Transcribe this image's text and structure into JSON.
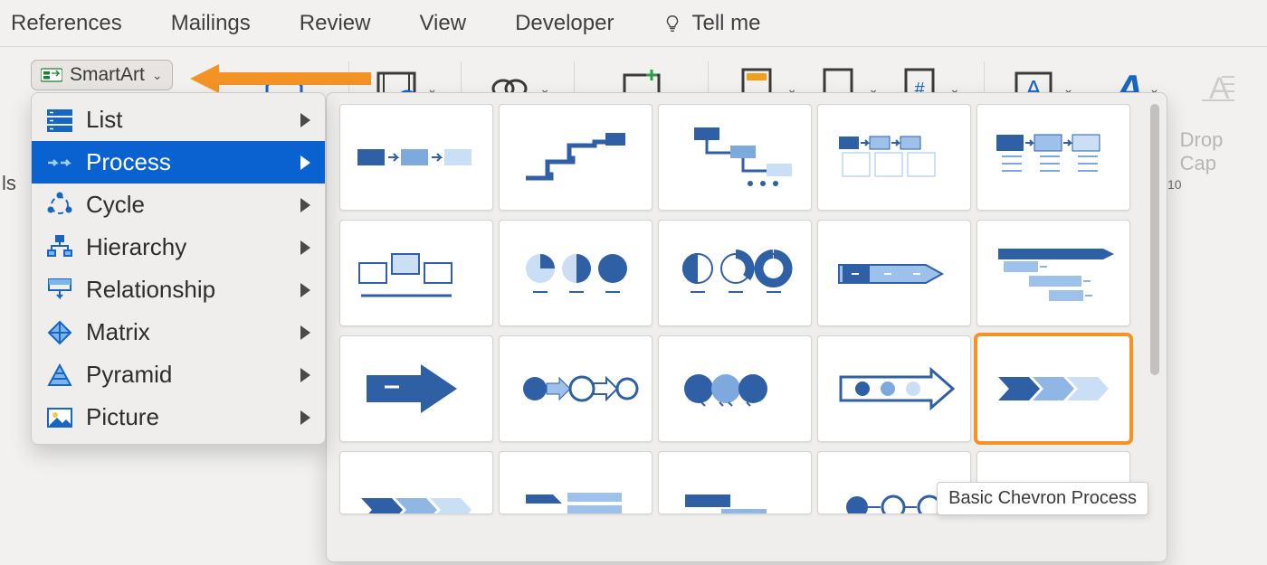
{
  "tabs": {
    "references": "References",
    "mailings": "Mailings",
    "review": "Review",
    "view": "View",
    "developer": "Developer",
    "tellme": "Tell me"
  },
  "ribbon": {
    "smartart_label": "SmartArt",
    "media": "Media",
    "links": "Links",
    "comment": "Comment",
    "header": "Header",
    "footer": "Footer",
    "page": "Page",
    "textbox": "Text Box",
    "wordart": "WordArt",
    "dropcap": "Drop Cap"
  },
  "smartart_menu": {
    "items": [
      {
        "label": "List",
        "icon": "list"
      },
      {
        "label": "Process",
        "icon": "process",
        "selected": true
      },
      {
        "label": "Cycle",
        "icon": "cycle"
      },
      {
        "label": "Hierarchy",
        "icon": "hierarchy"
      },
      {
        "label": "Relationship",
        "icon": "relationship"
      },
      {
        "label": "Matrix",
        "icon": "matrix"
      },
      {
        "label": "Pyramid",
        "icon": "pyramid"
      },
      {
        "label": "Picture",
        "icon": "picture"
      }
    ]
  },
  "gallery": {
    "highlight_index": 14,
    "tooltip": "Basic Chevron Process",
    "thumbnails": [
      "basic-process",
      "step-up-process",
      "step-down-process",
      "accent-process",
      "alternating-flow",
      "picture-accent-process",
      "pie-process",
      "increasing-circle-process",
      "arrow-ribbon",
      "converging-arrows",
      "large-arrow",
      "circle-arrow-repeating",
      "interconnected-circles",
      "dotted-arrow-process",
      "basic-chevron-process",
      "chevron-accent",
      "segmented-process",
      "staggered-process",
      "circle-connection",
      "opposing-ideas"
    ]
  },
  "ruler": {
    "mark": "10"
  },
  "leftstub": "ls"
}
